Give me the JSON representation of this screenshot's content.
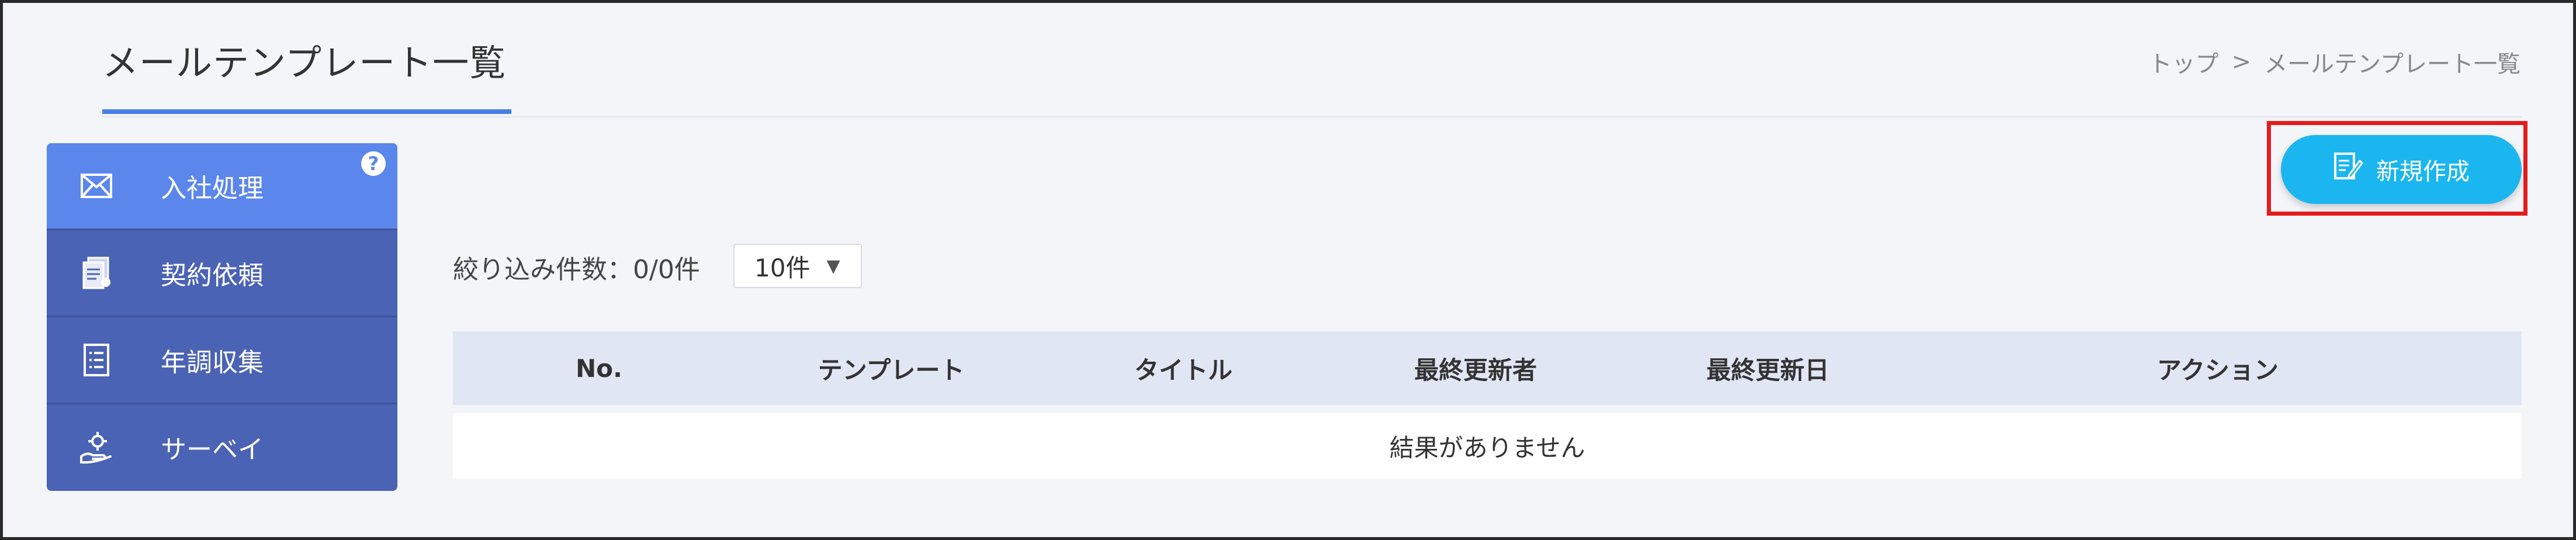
{
  "header": {
    "title": "メールテンプレート一覧",
    "breadcrumb": {
      "home": "トップ",
      "separator": ">",
      "current": "メールテンプレート一覧"
    }
  },
  "sidebar": {
    "items": [
      {
        "label": "入社処理",
        "icon": "mail-icon",
        "active": true
      },
      {
        "label": "契約依頼",
        "icon": "document-stack-icon",
        "active": false
      },
      {
        "label": "年調収集",
        "icon": "checklist-icon",
        "active": false
      },
      {
        "label": "サーベイ",
        "icon": "hand-gear-icon",
        "active": false
      }
    ],
    "help_label": "?"
  },
  "toolbar": {
    "new_label": "新規作成",
    "new_icon": "edit-document-icon"
  },
  "filter": {
    "count_label": "絞り込み件数：0/0件",
    "page_size": "10件"
  },
  "table": {
    "columns": [
      "No.",
      "テンプレート",
      "タイトル",
      "最終更新者",
      "最終更新日",
      "アクション"
    ],
    "empty_message": "結果がありません"
  },
  "colors": {
    "sidebar": "#4b63b5",
    "sidebar_active": "#5b86ec",
    "primary_button": "#1bb6f0",
    "highlight": "#e51c1c",
    "title_underline": "#4a7fe6",
    "table_header": "#e1e6f5"
  }
}
